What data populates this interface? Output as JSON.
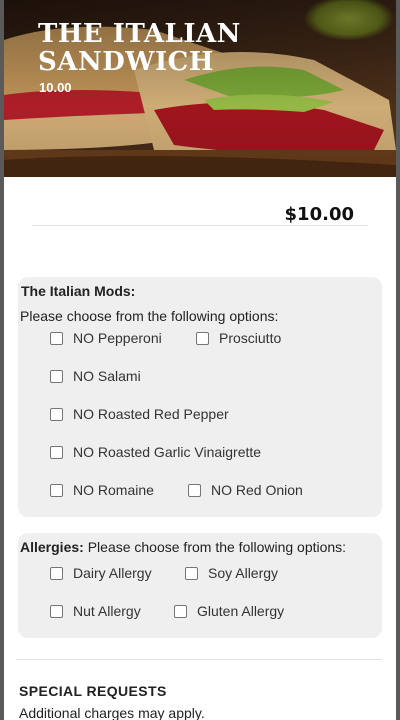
{
  "item": {
    "title": "THE ITALIAN SANDWICH",
    "hero_price": "10.00",
    "price": "$10.00"
  },
  "mods": {
    "title": "The Italian Mods:",
    "subtitle": "Please choose from the following options:",
    "options": [
      {
        "label": "NO Pepperoni",
        "checked": false
      },
      {
        "label": "Prosciutto",
        "checked": false
      },
      {
        "label": "NO Salami",
        "checked": false
      },
      {
        "label": "NO Roasted Red Pepper",
        "checked": false
      },
      {
        "label": "NO Roasted Garlic Vinaigrette",
        "checked": false
      },
      {
        "label": "NO Romaine",
        "checked": false
      },
      {
        "label": "NO Red Onion",
        "checked": false
      }
    ]
  },
  "allergies": {
    "title": "Allergies:",
    "subtitle": "Please choose from the following options:",
    "options": [
      {
        "label": "Dairy Allergy",
        "checked": false
      },
      {
        "label": "Soy Allergy",
        "checked": false
      },
      {
        "label": "Nut Allergy",
        "checked": false
      },
      {
        "label": "Gluten Allergy",
        "checked": false
      }
    ]
  },
  "special_requests": {
    "title": "SPECIAL REQUESTS",
    "note": "Additional charges may apply."
  },
  "colors": {
    "group_bg": "#f0efef",
    "overlay": "#5a5a5a"
  }
}
